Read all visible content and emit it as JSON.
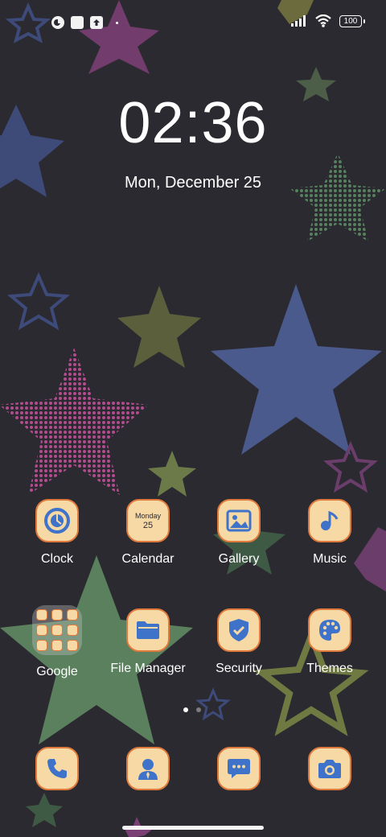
{
  "status_bar": {
    "battery": "100",
    "left_icons": [
      "cast-icon",
      "square-icon",
      "upload-icon"
    ],
    "right_icons": [
      "signal-icon",
      "wifi-icon",
      "battery-icon"
    ]
  },
  "lockscreen": {
    "time": "02:36",
    "date": "Mon, December 25"
  },
  "apps": {
    "clock": {
      "label": "Clock",
      "icon": "clock-icon"
    },
    "calendar": {
      "label": "Calendar",
      "icon": "calendar-icon",
      "weekday": "Monday",
      "day": "25"
    },
    "gallery": {
      "label": "Gallery",
      "icon": "gallery-icon"
    },
    "music": {
      "label": "Music",
      "icon": "music-icon"
    },
    "google": {
      "label": "Google",
      "icon": "folder-icon"
    },
    "file_manager": {
      "label": "File Manager",
      "icon": "folder-icon"
    },
    "security": {
      "label": "Security",
      "icon": "shield-icon"
    },
    "themes": {
      "label": "Themes",
      "icon": "palette-icon"
    }
  },
  "dock": [
    "phone-icon",
    "contacts-icon",
    "messages-icon",
    "camera-icon"
  ],
  "pager": {
    "pages": 2,
    "active": 0
  },
  "colors": {
    "background": "#2b2a30",
    "tile": "#f7d9a6",
    "tile_border": "#e07a3c",
    "icon_blue": "#3e73c9"
  }
}
